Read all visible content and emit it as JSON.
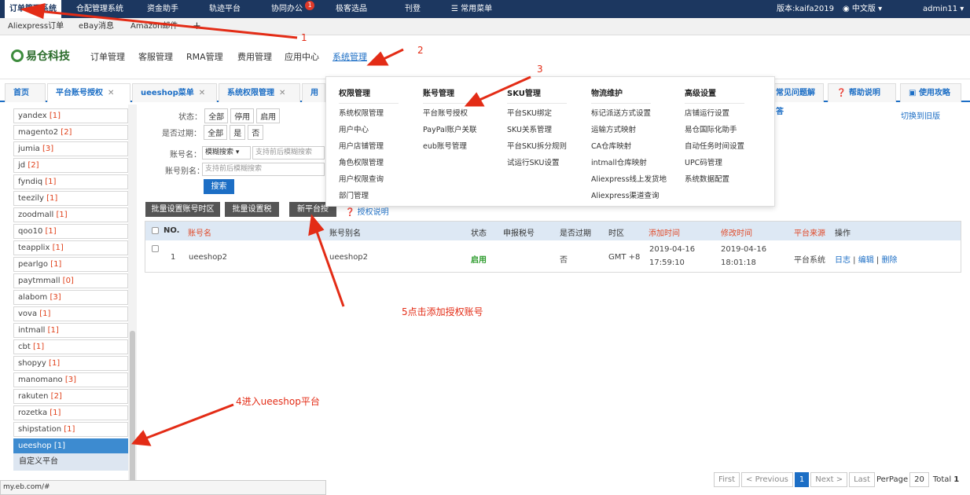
{
  "topbar": {
    "items": [
      "订单管理系统",
      "仓配管理系统",
      "资金助手",
      "轨迹平台",
      "协同办公",
      "极客选品",
      "刊登",
      "常用菜单"
    ],
    "badge": "1",
    "version": "版本:kaifa2019",
    "lang": "中文版",
    "user": "admin11"
  },
  "subtabs": [
    "Aliexpress订单",
    "eBay消息",
    "Amazon邮件",
    "+"
  ],
  "header": {
    "logo": "易仓科技",
    "nav": [
      "订单管理",
      "客服管理",
      "RMA管理",
      "费用管理",
      "应用中心",
      "系统管理"
    ]
  },
  "pagetabs": {
    "items": [
      "首页",
      "平台账号授权",
      "ueeshop菜单",
      "系统权限管理",
      "用户"
    ],
    "right": [
      "常见问题解答",
      "帮助说明",
      "使用攻略"
    ]
  },
  "sidebar": {
    "items": [
      {
        "name": "yandex",
        "count": "[1]"
      },
      {
        "name": "magento2",
        "count": "[2]"
      },
      {
        "name": "jumia",
        "count": "[3]"
      },
      {
        "name": "jd",
        "count": "[2]"
      },
      {
        "name": "fyndiq",
        "count": "[1]"
      },
      {
        "name": "teezily",
        "count": "[1]"
      },
      {
        "name": "zoodmall",
        "count": "[1]"
      },
      {
        "name": "qoo10",
        "count": "[1]"
      },
      {
        "name": "teapplix",
        "count": "[1]"
      },
      {
        "name": "pearlgo",
        "count": "[1]"
      },
      {
        "name": "paytmmall",
        "count": "[0]"
      },
      {
        "name": "alabom",
        "count": "[3]"
      },
      {
        "name": "vova",
        "count": "[1]"
      },
      {
        "name": "intmall",
        "count": "[1]"
      },
      {
        "name": "cbt",
        "count": "[1]"
      },
      {
        "name": "shopyy",
        "count": "[1]"
      },
      {
        "name": "manomano",
        "count": "[3]"
      },
      {
        "name": "rakuten",
        "count": "[2]"
      },
      {
        "name": "rozetka",
        "count": "[1]"
      },
      {
        "name": "shipstation",
        "count": "[1]"
      },
      {
        "name": "ueeshop",
        "count": "[1]"
      }
    ],
    "group": "自定义平台"
  },
  "filters": {
    "status_label": "状态：",
    "status_opts": [
      "全部",
      "停用",
      "启用"
    ],
    "expired_label": "是否过期：",
    "expired_opts": [
      "全部",
      "是",
      "否"
    ],
    "account_label": "账号名：",
    "account_mode": "模糊搜索",
    "account_placeholder": "支持前后模糊搜索",
    "alias_label": "账号别名：",
    "alias_placeholder": "支持前后模糊搜索",
    "search": "搜索",
    "switch_old": "切换到旧版"
  },
  "actions": [
    "批量设置账号时区",
    "批量设置税号",
    "新平台授权",
    "授权说明"
  ],
  "table": {
    "headers": [
      "NO.",
      "账号名",
      "账号别名",
      "状态",
      "申报税号",
      "是否过期",
      "时区",
      "添加时间",
      "修改时间",
      "平台来源",
      "操作"
    ],
    "row": {
      "no": "1",
      "account": "ueeshop2",
      "alias": "ueeshop2",
      "status": "启用",
      "tax": "",
      "expired": "否",
      "tz": "GMT +8",
      "added_date": "2019-04-16",
      "added_time": "17:59:10",
      "modified_date": "2019-04-16",
      "modified_time": "18:01:18",
      "source": "平台系统",
      "ops": [
        "日志",
        "编辑",
        "删除"
      ]
    }
  },
  "dropdown": {
    "cols": [
      {
        "title": "权限管理",
        "items": [
          "系统权限管理",
          "用户中心",
          "用户店铺管理",
          "角色权限管理",
          "用户权限查询",
          "部门管理"
        ]
      },
      {
        "title": "账号管理",
        "items": [
          "平台账号授权",
          "PayPal账户关联",
          "eub账号管理"
        ]
      },
      {
        "title": "SKU管理",
        "items": [
          "平台SKU绑定",
          "SKU关系管理",
          "平台SKU拆分规则",
          "试运行SKU设置"
        ]
      },
      {
        "title": "物流维护",
        "items": [
          "标记派送方式设置",
          "运输方式映射",
          "CA仓库映射",
          "intmall仓库映射",
          "Aliexpress线上发货地",
          "Aliexpress渠道查询"
        ]
      },
      {
        "title": "高级设置",
        "items": [
          "店铺运行设置",
          "易仓国际化助手",
          "自动任务时间设置",
          "UPC码管理",
          "系统数据配置"
        ]
      }
    ]
  },
  "pager": {
    "first": "First",
    "prev": "< Previous",
    "page": "1",
    "next": "Next >",
    "last": "Last",
    "perpage_label": "PerPage",
    "perpage": "20",
    "total_label": "Total",
    "total": "1"
  },
  "annotations": {
    "a1": "1",
    "a2": "2",
    "a3": "3",
    "a4": "4进入ueeshop平台",
    "a5": "5点击添加授权账号"
  },
  "status_url": "my.eb.com/#",
  "colors": {
    "topbar": "#1c3760",
    "link": "#1c6ec5",
    "annotation": "#e32c16",
    "active_side": "#3d8bd0"
  }
}
